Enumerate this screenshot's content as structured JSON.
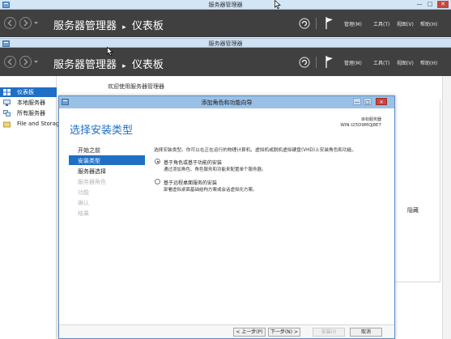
{
  "outer_window": {
    "title": "服务器管理器",
    "controls": {
      "minimize": "—",
      "maximize": "□",
      "close": "✕"
    }
  },
  "header": {
    "app_title": "服务器管理器",
    "breadcrumb_separator": "▸",
    "breadcrumb_page": "仪表板",
    "menu": {
      "manage": "管理(M)",
      "tools": "工具(T)",
      "view": "视图(V)",
      "help": "帮助(H)"
    }
  },
  "second_window": {
    "title": "服务器管理器",
    "header": {
      "app_title": "服务器管理器",
      "breadcrumb_separator": "▸",
      "breadcrumb_page": "仪表板",
      "menu": {
        "manage": "管理(M)",
        "tools": "工具(T)",
        "view": "视图(V)",
        "help": "帮助(H)"
      }
    }
  },
  "sidebar": {
    "items": [
      {
        "label": "仪表板",
        "active": true
      },
      {
        "label": "本地服务器",
        "active": false
      },
      {
        "label": "所有服务器",
        "active": false
      },
      {
        "label": "File and Storag",
        "active": false
      }
    ]
  },
  "main": {
    "welcome": "欢迎使用服务器管理器",
    "hide": "隐藏"
  },
  "wizard": {
    "title": "添加角色和功能向导",
    "heading": "选择安装类型",
    "destination_label": "目标服务器",
    "destination_server": "WIN-I25D9MQJ8E7",
    "steps": [
      {
        "label": "开始之前",
        "state": "normal"
      },
      {
        "label": "安装类型",
        "state": "active"
      },
      {
        "label": "服务器选择",
        "state": "normal"
      },
      {
        "label": "服务器角色",
        "state": "disabled"
      },
      {
        "label": "功能",
        "state": "disabled"
      },
      {
        "label": "确认",
        "state": "disabled"
      },
      {
        "label": "结果",
        "state": "disabled"
      }
    ],
    "intro": "选择安装类型。你可以在正在运行的物理计算机、虚拟机或脱机虚拟硬盘(VHD)上安装角色和功能。",
    "options": [
      {
        "title": "基于角色或基于功能的安装",
        "description": "通过添加角色、角色服务和功能来配置单个服务器。",
        "checked": true
      },
      {
        "title": "基于远程桌面服务的安装",
        "description": "部署虚拟桌面基础结构方案或会话虚拟化方案。",
        "checked": false
      }
    ],
    "buttons": {
      "previous": "< 上一步(P)",
      "next": "下一步(N) >",
      "install": "安装(I)",
      "cancel": "取消"
    }
  },
  "colors": {
    "accent": "#1f6fc5",
    "header_bg": "#404040",
    "titlebar_bg": "#d3e6f6",
    "close_red": "#c7463f"
  }
}
